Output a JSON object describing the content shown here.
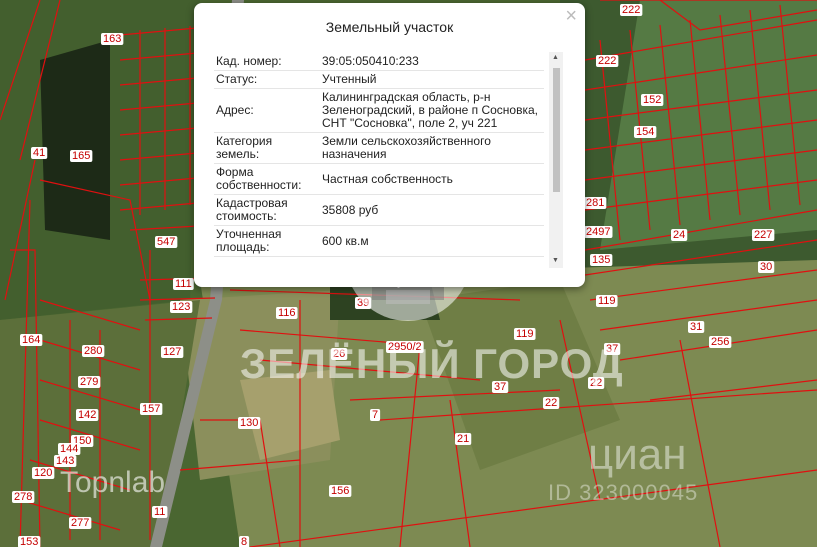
{
  "popup": {
    "title": "Земельный участок",
    "close_glyph": "×",
    "rows": [
      {
        "key": "Кад. номер:",
        "value": "39:05:050410:233"
      },
      {
        "key": "Статус:",
        "value": "Учтенный"
      },
      {
        "key": "Адрес:",
        "value": "Калининградская область, р-н Зеленоградский, в районе п Сосновка, СНТ \"Сосновка\", поле 2, уч 221"
      },
      {
        "key": "Категория земель:",
        "value": "Земли сельскохозяйственного назначения"
      },
      {
        "key": "Форма собственности:",
        "value": "Частная собственность"
      },
      {
        "key": "Кадастровая стоимость:",
        "value": "35808 руб"
      },
      {
        "key": "Уточненная площадь:",
        "value": "600 кв.м"
      }
    ]
  },
  "watermarks": {
    "green_city": "ЗЕЛЁНЫЙ ГОРОД",
    "topnlab": "Topnlab",
    "cian": "циан",
    "cian_id": "ID 323000045"
  },
  "plot_labels": [
    "222",
    "163",
    "222",
    "152",
    "154",
    "41",
    "165",
    "281",
    "2497",
    "24",
    "227",
    "135",
    "30",
    "547",
    "111",
    "119",
    "123",
    "116",
    "39",
    "31",
    "164",
    "127",
    "26",
    "2950/2",
    "119",
    "256",
    "280",
    "37",
    "279",
    "37",
    "22",
    "157",
    "22",
    "142",
    "7",
    "150",
    "130",
    "21",
    "144",
    "143",
    "120",
    "156",
    "278",
    "11",
    "277",
    "153",
    "8"
  ],
  "colors": {
    "parcel_line": "#e01010",
    "label_text": "#c40000",
    "popup_bg": "#ffffff"
  }
}
